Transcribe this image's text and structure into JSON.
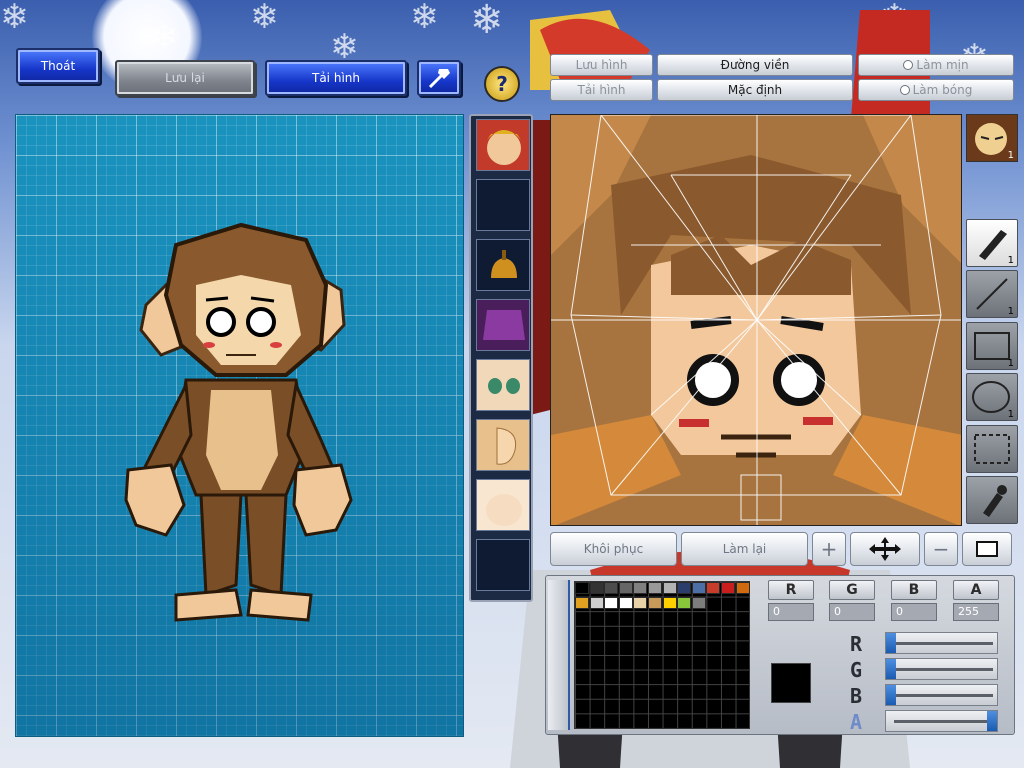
{
  "top_left": {
    "exit_label": "Thoát",
    "save_label": "Lưu lại",
    "reload_label": "Tải hình"
  },
  "top_right": {
    "save_image_label": "Lưu hình",
    "load_image_label": "Tải hình",
    "outline_label": "Đường viền",
    "default_label": "Mặc định",
    "smooth_label": "Làm mịn",
    "gloss_label": "Làm bóng"
  },
  "editor_buttons": {
    "restore_label": "Khôi phục",
    "redo_label": "Làm lại"
  },
  "tools": [
    {
      "name": "brush",
      "count": "1"
    },
    {
      "name": "line",
      "count": "1"
    },
    {
      "name": "rectangle",
      "count": "1"
    },
    {
      "name": "ellipse",
      "count": "1"
    },
    {
      "name": "select",
      "count": ""
    },
    {
      "name": "eyedropper",
      "count": ""
    }
  ],
  "face_badge_count": "1",
  "color": {
    "r_label": "R",
    "g_label": "G",
    "b_label": "B",
    "a_label": "A",
    "r_value": "0",
    "g_value": "0",
    "b_value": "0",
    "a_value": "255",
    "current_color": "#000000"
  },
  "palette": [
    "#000000",
    "#333333",
    "#4d4d4d",
    "#666666",
    "#808080",
    "#999999",
    "#b3b3b3",
    "#2b3d6b",
    "#4c6fa8",
    "#c83c2b",
    "#c81e1e",
    "#d06a10",
    "#e0a020",
    "#cfcfcf",
    "#ffffff",
    "#ffffff",
    "#e8d2a8",
    "#c89a5a",
    "#ffd000",
    "#8ac43a",
    "#7d7d7d"
  ],
  "colors": {
    "canvas_bg": "#1a93bf",
    "button_blue": "#1636c9"
  }
}
